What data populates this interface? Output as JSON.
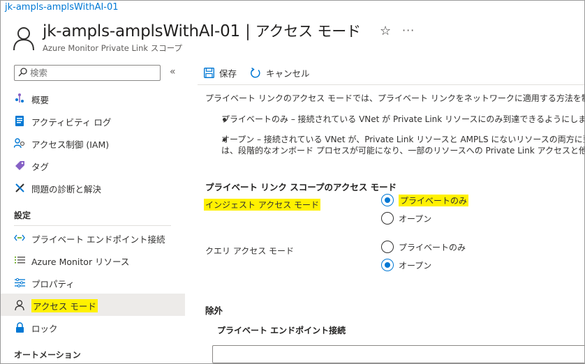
{
  "breadcrumb": "jk-ampls-amplsWithAI-01",
  "header": {
    "resource_name": "jk-ampls-amplsWithAI-01",
    "separator": "|",
    "page_name": "アクセス モード",
    "subtitle": "Azure Monitor Private Link スコープ",
    "favorite_icon": "star-icon",
    "more_icon": "more-icon"
  },
  "sidebar": {
    "search_placeholder": "検索",
    "items": [
      {
        "label": "概要",
        "icon": "overview-icon"
      },
      {
        "label": "アクティビティ ログ",
        "icon": "activity-log-icon"
      },
      {
        "label": "アクセス制御 (IAM)",
        "icon": "iam-icon"
      },
      {
        "label": "タグ",
        "icon": "tag-icon"
      },
      {
        "label": "問題の診断と解決",
        "icon": "wrench-icon"
      }
    ],
    "section_settings": "設定",
    "settings_items": [
      {
        "label": "プライベート エンドポイント接続",
        "icon": "endpoint-icon"
      },
      {
        "label": "Azure Monitor リソース",
        "icon": "list-icon"
      },
      {
        "label": "プロパティ",
        "icon": "properties-icon"
      },
      {
        "label": "アクセス モード",
        "icon": "person-icon",
        "active": true
      },
      {
        "label": "ロック",
        "icon": "lock-icon"
      }
    ],
    "section_automation": "オートメーション"
  },
  "toolbar": {
    "save_label": "保存",
    "cancel_label": "キャンセル"
  },
  "main": {
    "description": "プライベート リンクのアクセス モードでは、プライベート リンクをネットワークに適用する方法を制御し、ネットワー",
    "bullet1": "プライベートのみ – 接続されている VNet が Private Link リソースにのみ到達できるようにします。",
    "bullet2_line1": "オープン – 接続されている VNet が、Private Link リソースと AMPLS にないリソースの両方に到",
    "bullet2_line2": "は、段階的なオンボード プロセスが可能になり、一部のリソースへの Private Link アクセスと他のリ",
    "scope_title": "プライベート リンク スコープのアクセス モード",
    "ingest_label": "インジェスト アクセス モード",
    "ingest_options": [
      "プライベートのみ",
      "オープン"
    ],
    "ingest_selected": "プライベートのみ",
    "query_label": "クエリ アクセス モード",
    "query_options": [
      "プライベートのみ",
      "オープン"
    ],
    "query_selected": "オープン",
    "exclusion_title": "除外",
    "endpoint_connection_title": "プライベート エンドポイント接続",
    "endpoint_input_value": ""
  },
  "colors": {
    "accent": "#0078d4",
    "highlight": "#fff100",
    "text": "#323130"
  }
}
